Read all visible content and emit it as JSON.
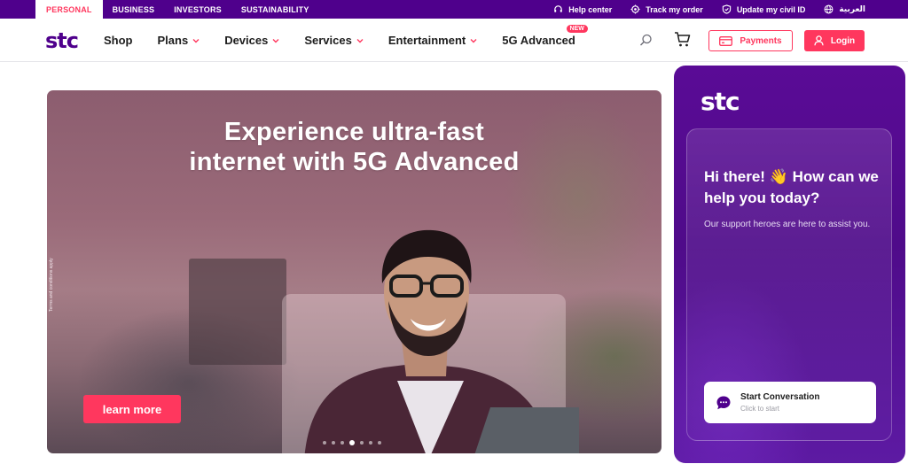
{
  "topbar": {
    "segments": [
      "PERSONAL",
      "BUSINESS",
      "INVESTORS",
      "SUSTAINABILITY"
    ],
    "active_segment": "PERSONAL",
    "help_center": "Help center",
    "track_order": "Track my order",
    "update_civil_id": "Update my civil ID",
    "language": "العربية"
  },
  "nav": {
    "logo_text": "stc",
    "shop": "Shop",
    "plans": "Plans",
    "devices": "Devices",
    "services": "Services",
    "entertainment": "Entertainment",
    "five_g": "5G Advanced",
    "new_badge": "NEW",
    "payments": "Payments",
    "login": "Login"
  },
  "hero": {
    "title_line1": "Experience ultra-fast",
    "title_line2": "internet with 5G Advanced",
    "terms": "Terms and conditions apply",
    "cta": "learn more",
    "slides_total": 7,
    "active_slide": 4
  },
  "chat": {
    "logo_text": "stc",
    "greeting": "Hi there! 👋 How can we help you today?",
    "subtitle": "Our support heroes are here to assist you.",
    "start_title": "Start Conversation",
    "start_subtitle": "Click to start"
  },
  "colors": {
    "brand_purple": "#4f008c",
    "accent_coral": "#ff375e"
  }
}
